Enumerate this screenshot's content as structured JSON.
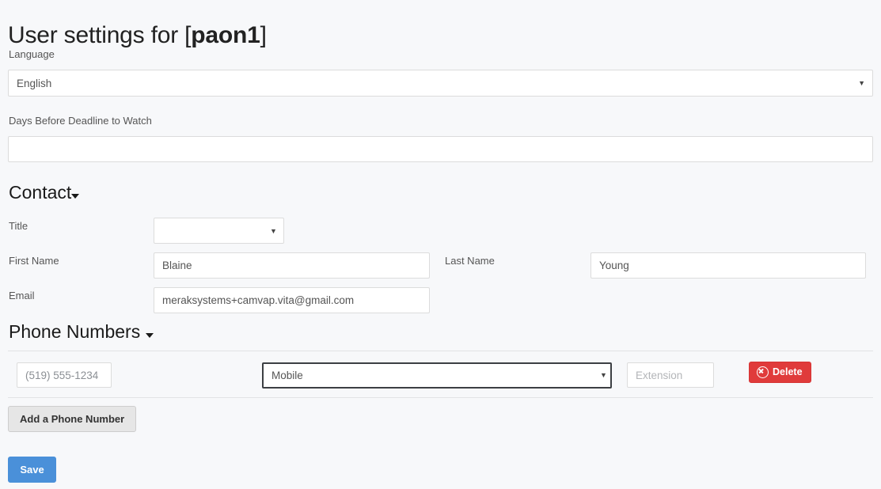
{
  "header": {
    "title_prefix": "User settings for [",
    "username": "paon1",
    "title_suffix": "]"
  },
  "language_field": {
    "label": "Language",
    "value": "English",
    "caret_icon": "chevron-down-icon"
  },
  "days_field": {
    "label": "Days Before Deadline to Watch",
    "value": "",
    "placeholder": ""
  },
  "contact_section": {
    "heading": "Contact",
    "caret_icon": "caret-down-icon",
    "title_field": {
      "label": "Title",
      "value": "",
      "caret_icon": "chevron-down-icon"
    },
    "first_name_field": {
      "label": "First Name",
      "value": "Blaine",
      "placeholder": ""
    },
    "last_name_field": {
      "label": "Last Name",
      "value": "Young",
      "placeholder": ""
    },
    "email_field": {
      "label": "Email",
      "value": "meraksystems+camvap.vita@gmail.com",
      "placeholder": ""
    }
  },
  "phones_section": {
    "heading": "Phone Numbers",
    "caret_icon": "caret-down-icon",
    "rows": [
      {
        "number": "(519) 555-1234",
        "number_placeholder": "(519) 555-1234",
        "type": "Mobile",
        "type_caret_icon": "chevron-down-icon",
        "extension": "",
        "extension_placeholder": "Extension",
        "delete_label": "Delete",
        "delete_icon": "times-circle-icon"
      }
    ],
    "add_button_label": "Add a Phone Number"
  },
  "footer": {
    "save_label": "Save"
  },
  "colors": {
    "page_background": "#f7f8fa",
    "input_border": "#dcdcdc",
    "focus_border": "#3c3f43",
    "delete_red": "#e03b3b",
    "save_blue": "#4a90d9",
    "add_button_grey": "#e6e6e6",
    "divider": "#e2e3e5",
    "label_text": "#555555"
  }
}
